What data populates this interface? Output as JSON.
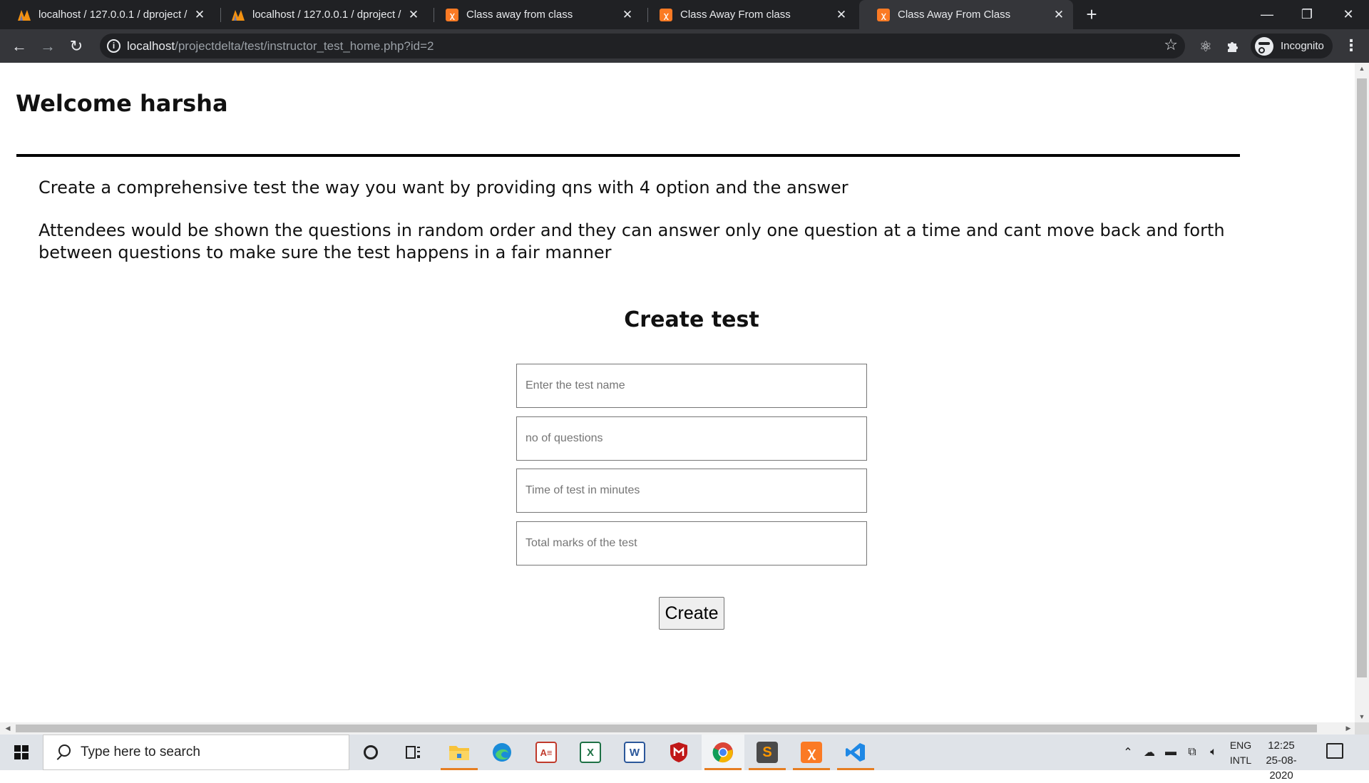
{
  "browser": {
    "tabs": [
      {
        "title": "localhost / 127.0.0.1 / dproject / ",
        "favicon": "phpmyadmin-icon",
        "active": false
      },
      {
        "title": "localhost / 127.0.0.1 / dproject / ",
        "favicon": "phpmyadmin-icon",
        "active": false
      },
      {
        "title": "Class away from class",
        "favicon": "xampp-icon",
        "active": false
      },
      {
        "title": "Class Away From class",
        "favicon": "xampp-icon",
        "active": false
      },
      {
        "title": "Class Away From Class",
        "favicon": "xampp-icon",
        "active": true
      }
    ],
    "url_host": "localhost",
    "url_path": "/projectdelta/test/instructor_test_home.php?id=2",
    "profile_label": "Incognito"
  },
  "page": {
    "welcome": "Welcome harsha",
    "description": [
      "Create a comprehensive test the way you want by providing qns with 4 option and the answer",
      "Attendees would be shown the questions in random order and they can answer only one question at a time and cant move back and forth between questions to make sure the test happens in a fair manner"
    ],
    "form_title": "Create test",
    "fields": {
      "test_name": {
        "value": "",
        "placeholder": "Enter the test name"
      },
      "num_questions": {
        "value": "",
        "placeholder": "no of questions"
      },
      "time_minutes": {
        "value": "",
        "placeholder": "Time of test in minutes"
      },
      "total_marks": {
        "value": "",
        "placeholder": "Total marks of the test"
      }
    },
    "submit_label": "Create"
  },
  "taskbar": {
    "search_placeholder": "Type here to search",
    "lang_line1": "ENG",
    "lang_line2": "INTL",
    "time": "12:25",
    "date": "25-08-2020",
    "apps": [
      "cortana",
      "task-view",
      "file-explorer",
      "edge",
      "access",
      "excel",
      "word",
      "mcafee",
      "chrome",
      "sublime-text",
      "xampp",
      "vscode"
    ]
  },
  "colors": {
    "chrome_dark": "#202124",
    "chrome_toolbar": "#35363a",
    "xampp_orange": "#fb7a24",
    "taskbar_bg": "#dfe3e8"
  }
}
